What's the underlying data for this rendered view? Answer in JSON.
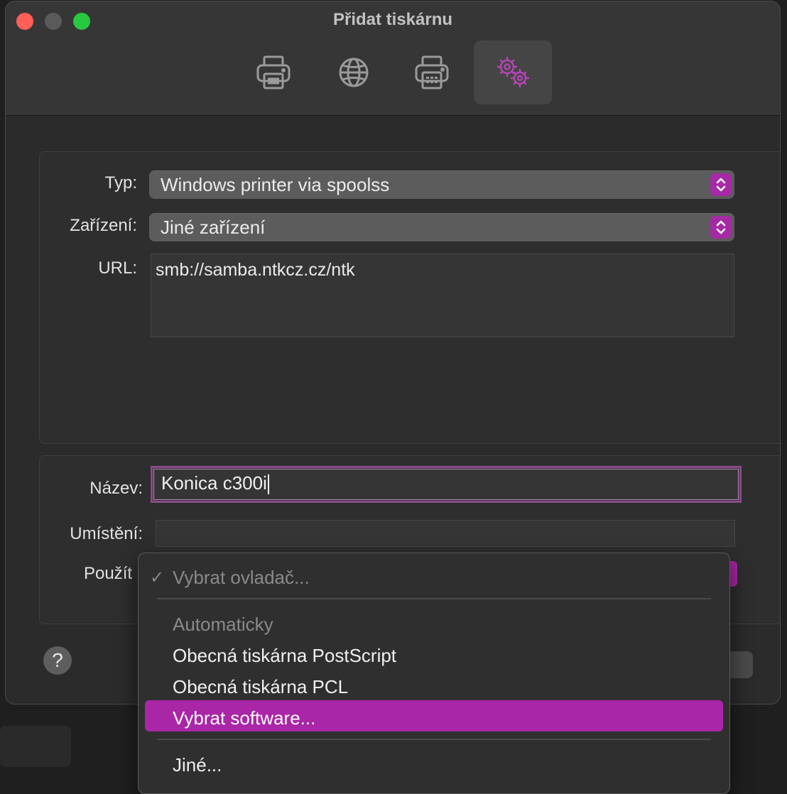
{
  "window": {
    "title": "Přidat tiskárnu"
  },
  "toolbar": {
    "items": [
      {
        "icon": "printer-icon",
        "active": false
      },
      {
        "icon": "globe-icon",
        "active": false
      },
      {
        "icon": "fax-printer-icon",
        "active": false
      },
      {
        "icon": "gears-icon",
        "active": true
      }
    ],
    "accent": "#a926a6"
  },
  "form": {
    "type_label": "Typ:",
    "type_value": "Windows printer via spoolss",
    "device_label": "Zařízení:",
    "device_value": "Jiné zařízení",
    "url_label": "URL:",
    "url_value": "smb://samba.ntkcz.cz/ntk"
  },
  "details": {
    "name_label": "Název:",
    "name_value": "Konica c300i",
    "location_label": "Umístění:",
    "location_value": "",
    "use_label": "Použít"
  },
  "menu": {
    "selected": "Vybrat ovladač...",
    "section_header": "Automaticky",
    "items": [
      "Obecná tiskárna PostScript",
      "Obecná tiskárna PCL",
      "Vybrat software..."
    ],
    "other": "Jiné...",
    "highlight_color": "#a926a6"
  },
  "help": {
    "label": "?"
  }
}
